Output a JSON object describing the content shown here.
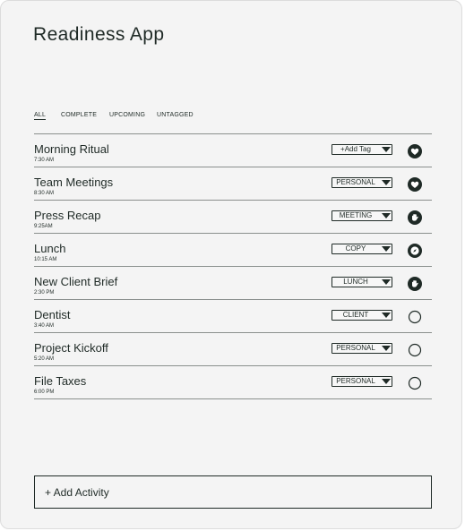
{
  "app": {
    "title": "Readiness App"
  },
  "filters": [
    {
      "label": "ALL",
      "active": true
    },
    {
      "label": "COMPLETE",
      "active": false
    },
    {
      "label": "UPCOMING",
      "active": false
    },
    {
      "label": "UNTAGGED",
      "active": false
    }
  ],
  "activities": [
    {
      "name": "Morning Ritual",
      "time": "7:30 AM",
      "tag": "+Add Tag",
      "status_icon": "heart-icon"
    },
    {
      "name": "Team Meetings",
      "time": "8:30 AM",
      "tag": "PERSONAL",
      "status_icon": "heart-icon"
    },
    {
      "name": "Press Recap",
      "time": "9:25AM",
      "tag": "MEETING",
      "status_icon": "hand-icon"
    },
    {
      "name": "Lunch",
      "time": "10:15 AM",
      "tag": "COPY",
      "status_icon": "compass-icon"
    },
    {
      "name": "New Client Brief",
      "time": "2:30 PM",
      "tag": "LUNCH",
      "status_icon": "hand-icon"
    },
    {
      "name": "Dentist",
      "time": "3:40 AM",
      "tag": "CLIENT",
      "status_icon": "empty-circle-icon"
    },
    {
      "name": "Project Kickoff",
      "time": "5:20 AM",
      "tag": "PERSONAL",
      "status_icon": "empty-circle-icon"
    },
    {
      "name": "File Taxes",
      "time": "6:00 PM",
      "tag": "PERSONAL",
      "status_icon": "empty-circle-icon"
    }
  ],
  "add_button": {
    "label": "+ Add Activity"
  },
  "colors": {
    "ink": "#1f2a26",
    "background": "#f4f4f4",
    "divider": "#8a8f8d"
  }
}
